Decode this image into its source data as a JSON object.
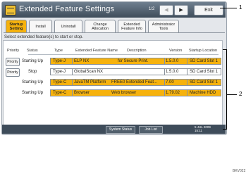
{
  "window": {
    "title": "Extended Feature Settings",
    "page_indicator": "1/2",
    "prev_label": "◀",
    "next_label": "▶",
    "exit_label": "Exit"
  },
  "tabs": [
    {
      "label": "Startup Setting",
      "active": true
    },
    {
      "label": "Install",
      "active": false
    },
    {
      "label": "Uninstall",
      "active": false
    },
    {
      "label": "Change Allocation",
      "active": false
    },
    {
      "label": "Extended Feature Info",
      "active": false
    },
    {
      "label": "Administrator Tools",
      "active": false
    }
  ],
  "instruction": "Select extended feature(s) to start or stop.",
  "table": {
    "headers": [
      "Priority",
      "Status",
      "Type",
      "Extended Feature Name",
      "Description",
      "Version",
      "Startup Location"
    ],
    "rows": [
      {
        "priority": "Priority",
        "status": "Starting Up",
        "type": "Type-J",
        "name": "ELP NX",
        "description": "for Secure Print.",
        "version": "1.5.0.0",
        "location": "SD Card Slot 1",
        "highlighted": true
      },
      {
        "priority": "Priority",
        "status": "Stop",
        "type": "Type-J",
        "name": "GlobalScan NX",
        "description": "",
        "version": "1.5.0.0",
        "location": "SD Card Slot 1",
        "highlighted": false
      },
      {
        "priority": "",
        "status": "Starting Up",
        "type": "Type-C",
        "name": "JavaTM Platform",
        "description": "FREE0 Extended Feat...",
        "version": "7.00",
        "location": "SD Card Slot 1",
        "highlighted": true
      },
      {
        "priority": "",
        "status": "Starting Up",
        "type": "Type-C",
        "name": "Browser",
        "description": "Web browser",
        "version": "1.79.02",
        "location": "Machine HDD",
        "highlighted": true
      }
    ]
  },
  "footer": {
    "system_status": "System Status",
    "job_list": "Job List",
    "datetime": "5 JUL 2009\n15:11"
  },
  "callouts": [
    "1",
    "2"
  ],
  "figure_code": "BKV022"
}
